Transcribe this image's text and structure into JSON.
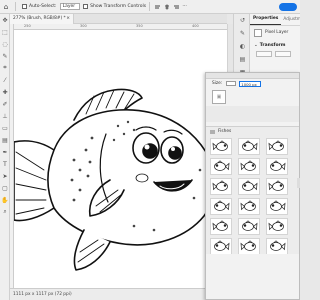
{
  "options_bar": {
    "auto_select_label": "Auto-Select:",
    "auto_select_target": "Layer",
    "show_transform_controls": "Show Transform Controls",
    "home_icon": "home-icon",
    "share_color": "#1473e6"
  },
  "document": {
    "tab_title": "277% (Brush, RGB/8#) *",
    "zoom": "277%"
  },
  "ruler": {
    "ticks": [
      "250",
      "300",
      "350",
      "400"
    ]
  },
  "status_bar": {
    "text": "1111 px x 1117 px (72 ppi)"
  },
  "properties_panel": {
    "tab_properties": "Properties",
    "tab_adjustments": "Adjustme",
    "layer_type": "Pixel Layer",
    "transform_section": "Transform"
  },
  "plugin_window": {
    "size_label": "Size:",
    "size_value": "1000 px",
    "presets_label": "Fishes",
    "preset_count": 18
  },
  "colors": {
    "accent": "#1473e6",
    "canvas_bg": "#ffffff",
    "ui_bg": "#efefef"
  }
}
